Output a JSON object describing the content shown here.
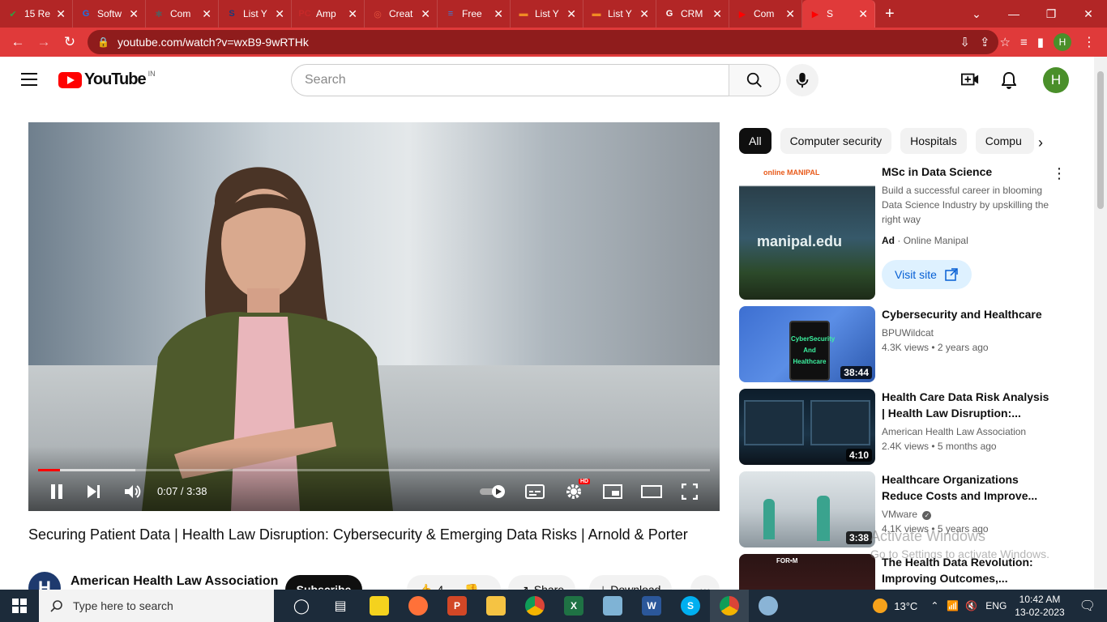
{
  "browser": {
    "tabs": [
      {
        "title": "15 Re",
        "color": "#2ea043",
        "glyph": "✔"
      },
      {
        "title": "Softw",
        "color": "#1a73e8",
        "glyph": "G"
      },
      {
        "title": "Com",
        "color": "#5a5a5a",
        "glyph": "✱"
      },
      {
        "title": "List Y",
        "color": "#1a3a7a",
        "glyph": "S"
      },
      {
        "title": "Amp",
        "color": "#c62828",
        "glyph": "PC"
      },
      {
        "title": "Creat",
        "color": "#e5533d",
        "glyph": "◎"
      },
      {
        "title": "Free",
        "color": "#3b7dd8",
        "glyph": "≡"
      },
      {
        "title": "List Y",
        "color": "#f08a24",
        "glyph": "▬"
      },
      {
        "title": "List Y",
        "color": "#f08a24",
        "glyph": "▬"
      },
      {
        "title": "CRM",
        "color": "#ffffff",
        "glyph": "G"
      },
      {
        "title": "Com",
        "color": "#ff0000",
        "glyph": "▶"
      },
      {
        "title": "S",
        "color": "#ff0000",
        "glyph": "▶"
      }
    ],
    "url": "youtube.com/watch?v=wxB9-9wRTHk",
    "profile_initial": "H"
  },
  "youtube": {
    "logo_text": "YouTube",
    "country": "IN",
    "search_placeholder": "Search",
    "avatar_initial": "H"
  },
  "player": {
    "progress_fraction": 0.032,
    "time": "0:07 / 3:38"
  },
  "video": {
    "title": "Securing Patient Data | Health Law Disruption: Cybersecurity & Emerging Data Risks | Arnold & Porter",
    "channel": "American Health Law Association",
    "channel_initial": "H",
    "subscribe_label": "Subscribe",
    "like_count": "4",
    "share_label": "Share",
    "download_label": "Download"
  },
  "chips": [
    "All",
    "Computer security",
    "Hospitals",
    "Compu"
  ],
  "ad": {
    "brand": "online MANIPAL",
    "title": "MSc in Data Science",
    "description": "Build a successful career in blooming Data Science Industry by upskilling the right way",
    "ad_label": "Ad",
    "advertiser": "Online Manipal",
    "cta": "Visit site",
    "thumb_text": "manipal.edu"
  },
  "recommendations": [
    {
      "title": "Cybersecurity and Healthcare",
      "channel": "BPUWildcat",
      "meta": "4.3K views • 2 years ago",
      "duration": "38:44",
      "thumb_text": "CyberSecurity And Healthcare"
    },
    {
      "title": "Health Care Data Risk Analysis | Health Law Disruption:...",
      "channel": "American Health Law Association",
      "meta": "2.4K views • 5 months ago",
      "duration": "4:10"
    },
    {
      "title": "Healthcare Organizations Reduce Costs and Improve...",
      "channel": "VMware",
      "meta": "4.1K views • 5 years ago",
      "duration": "3:38"
    },
    {
      "title": "The Health Data Revolution: Improving Outcomes,...",
      "thumb_text": "FOR•M"
    }
  ],
  "watermark": {
    "line1": "Activate Windows",
    "line2": "Go to Settings to activate Windows."
  },
  "taskbar": {
    "search_placeholder": "Type here to search",
    "temperature": "13°C",
    "language": "ENG",
    "time": "10:42 AM",
    "date": "13-02-2023"
  }
}
